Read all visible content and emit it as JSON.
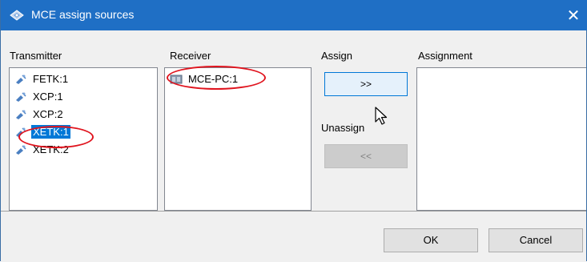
{
  "window": {
    "title": "MCE assign sources",
    "close_glyph": "✕",
    "title_icon": "satellite-dish-icon"
  },
  "columns": {
    "transmitter": "Transmitter",
    "receiver": "Receiver",
    "assign": "Assign",
    "assignment": "Assignment"
  },
  "transmitters": [
    {
      "label": "FETK:1",
      "selected": false
    },
    {
      "label": "XCP:1",
      "selected": false
    },
    {
      "label": "XCP:2",
      "selected": false
    },
    {
      "label": "XETK:1",
      "selected": true
    },
    {
      "label": "XETK:2",
      "selected": false
    }
  ],
  "receivers": [
    {
      "label": "MCE-PC:1",
      "icon": "computer-icon"
    }
  ],
  "assignments": [],
  "actions": {
    "assign_label": ">>",
    "unassign_heading": "Unassign",
    "unassign_label": "<<"
  },
  "footer": {
    "ok_label": "OK",
    "cancel_label": "Cancel"
  },
  "colors": {
    "titlebar": "#1f6fc5",
    "selection": "#0078d7",
    "highlight_ellipse": "#e0141e"
  }
}
